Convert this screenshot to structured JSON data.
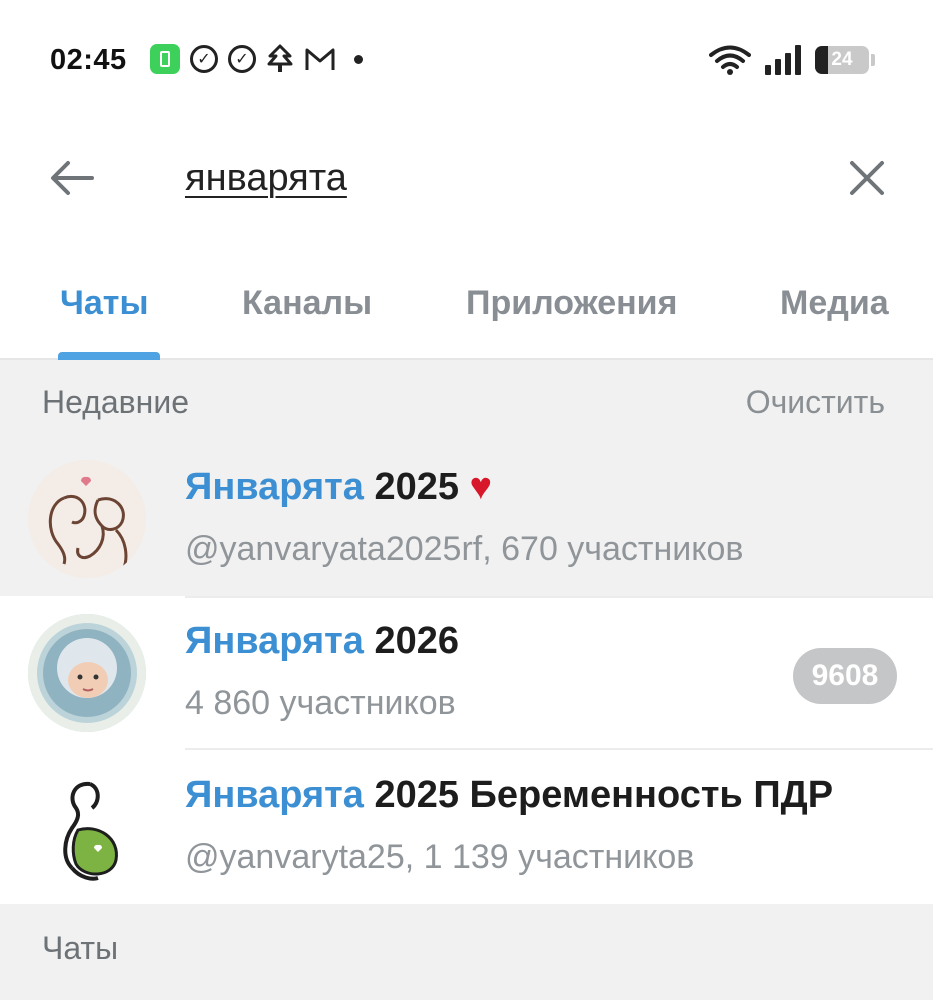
{
  "status_bar": {
    "time": "02:45",
    "battery_level": "24",
    "notification_icons": [
      "battery-saver-icon",
      "check-circle-icon",
      "check-circle-icon",
      "tree-icon",
      "gmail-icon",
      "dot-icon"
    ],
    "right_icons": [
      "wifi-icon",
      "signal-icon",
      "battery-icon"
    ]
  },
  "search": {
    "query": "январята",
    "back_icon": "arrow-left-icon",
    "clear_icon": "close-icon"
  },
  "tabs": [
    {
      "label": "Чаты",
      "active": true
    },
    {
      "label": "Каналы",
      "active": false
    },
    {
      "label": "Приложения",
      "active": false
    },
    {
      "label": "Медиа",
      "active": false
    }
  ],
  "recent": {
    "title": "Недавние",
    "clear_label": "Очистить",
    "items": [
      {
        "name_highlight": "Январята",
        "name_rest": " 2025",
        "emoji": "♥",
        "subtitle": "@yanvaryata2025rf, 670 участников",
        "badge": ""
      },
      {
        "name_highlight": "Январята",
        "name_rest": " 2026",
        "emoji": "",
        "subtitle": "4 860 участников",
        "badge": "9608"
      },
      {
        "name_highlight": "Январята",
        "name_rest": " 2025 Беременность ПДР",
        "emoji": "",
        "subtitle": "@yanvaryta25, 1 139 участников",
        "badge": ""
      }
    ]
  },
  "chats_section": {
    "title": "Чаты"
  },
  "colors": {
    "accent": "#3b8fd2",
    "tab_indicator": "#4fa3e3",
    "section_bg": "#f1f1f1",
    "badge_bg": "#c4c6c8",
    "heart": "#d8182a"
  }
}
